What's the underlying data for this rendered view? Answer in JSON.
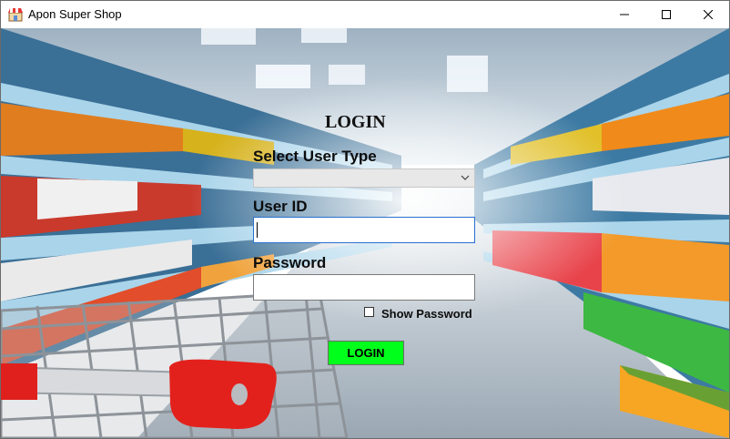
{
  "window": {
    "title": "Apon Super Shop",
    "icon": "shop-icon",
    "controls": [
      "minimize-icon",
      "maximize-icon",
      "close-icon"
    ]
  },
  "background": {
    "scene": "supermarket-aisle-with-shopping-cart"
  },
  "form": {
    "heading": "LOGIN",
    "user_type_label": "Select User Type",
    "user_type_value": "",
    "user_id_label": "User ID",
    "user_id_value": "",
    "password_label": "Password",
    "password_value": "",
    "show_password_label": "Show Password",
    "show_password_checked": false,
    "login_button": "LOGIN",
    "login_button_color": "#00ff1a"
  }
}
